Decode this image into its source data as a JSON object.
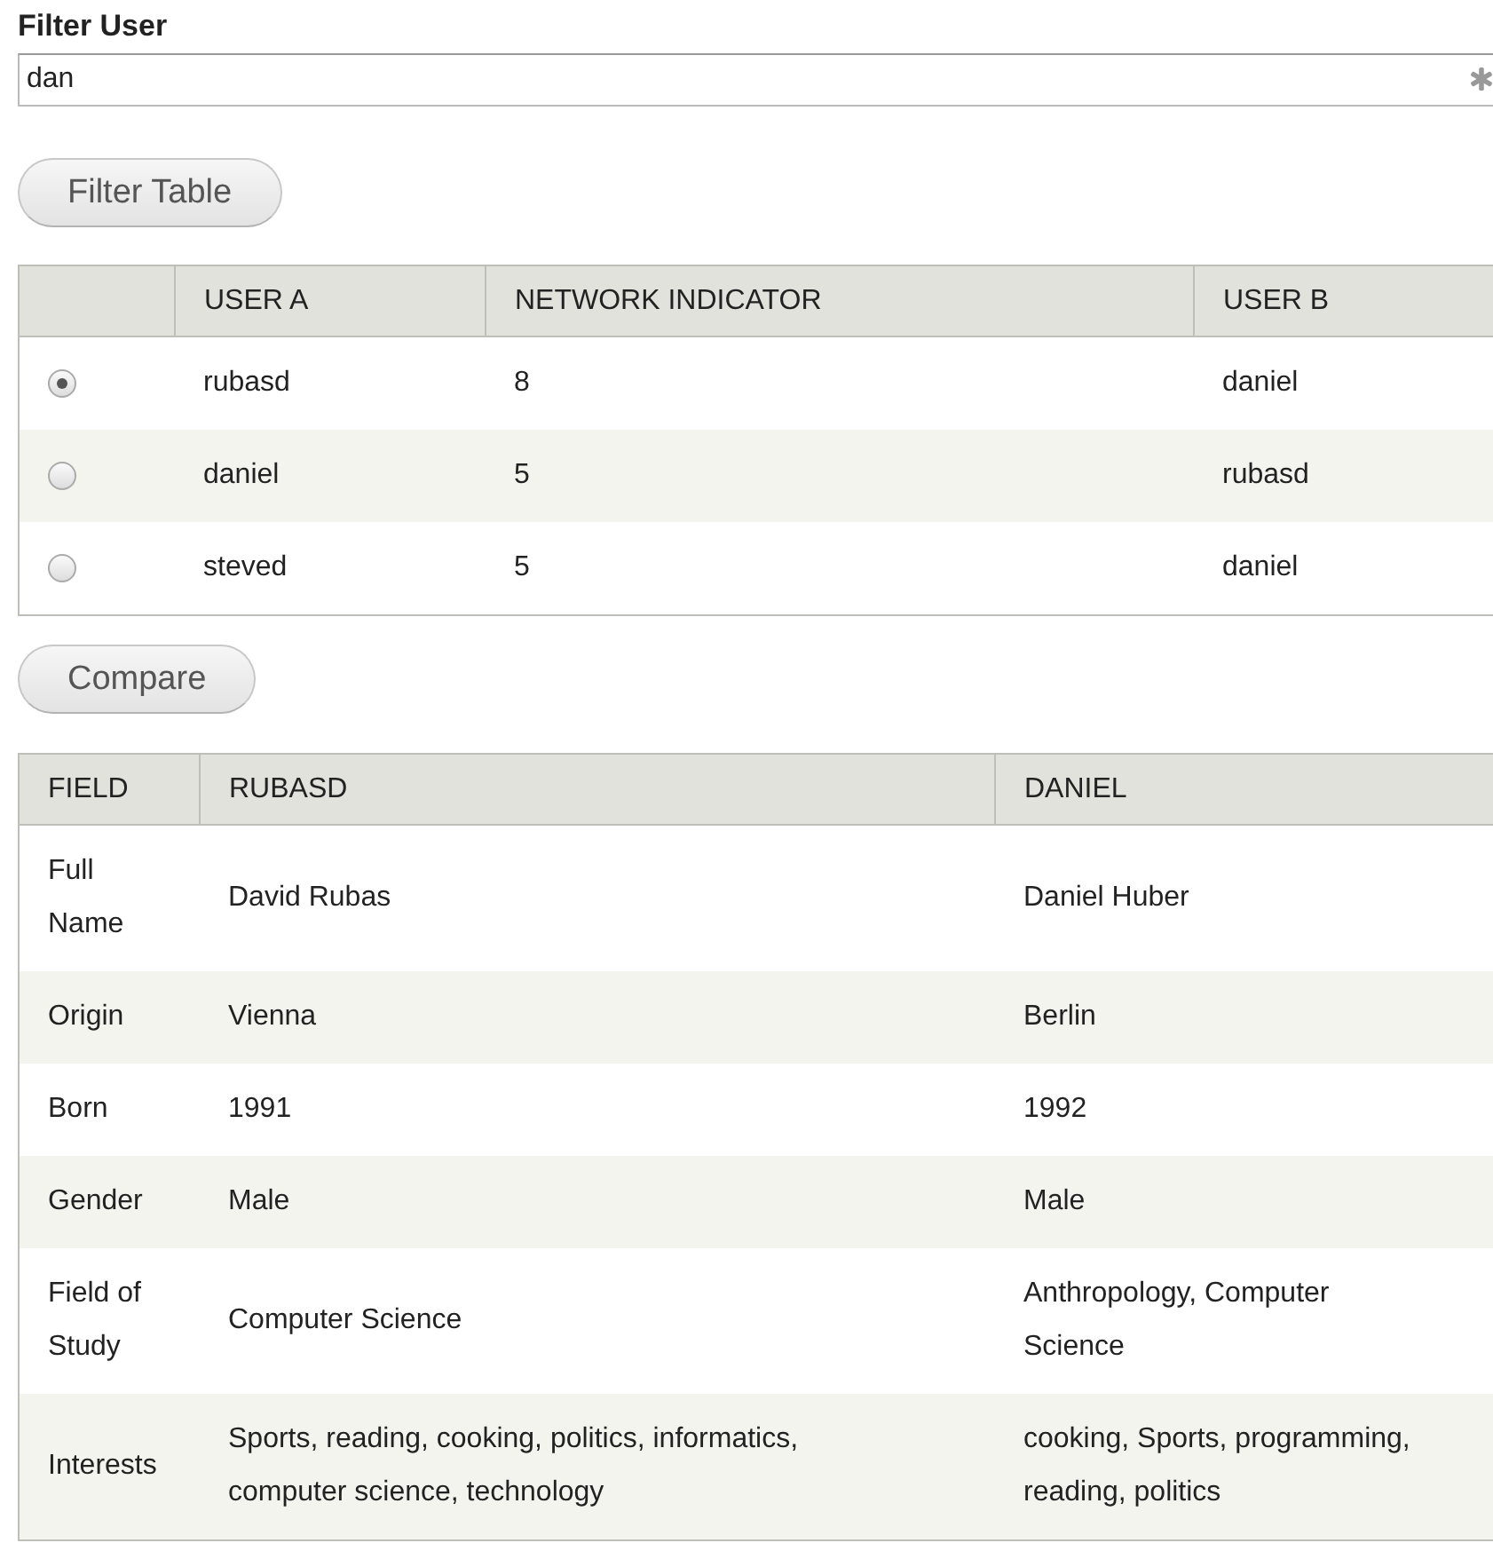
{
  "filter": {
    "label": "Filter User",
    "value": "dan"
  },
  "filter_button": "Filter Table",
  "network_table": {
    "columns": [
      "USER A",
      "NETWORK INDICATOR",
      "USER B"
    ],
    "rows": [
      {
        "selected": true,
        "cells": [
          "rubasd",
          "8",
          "daniel"
        ]
      },
      {
        "selected": false,
        "cells": [
          "daniel",
          "5",
          "rubasd"
        ]
      },
      {
        "selected": false,
        "cells": [
          "steved",
          "5",
          "daniel"
        ]
      }
    ]
  },
  "compare_button": "Compare",
  "compare_table": {
    "columns": [
      "FIELD",
      "RUBASD",
      "DANIEL"
    ],
    "rows": [
      [
        "Full Name",
        "David Rubas",
        "Daniel Huber"
      ],
      [
        "Origin",
        "Vienna",
        "Berlin"
      ],
      [
        "Born",
        "1991",
        "1992"
      ],
      [
        "Gender",
        "Male",
        "Male"
      ],
      [
        "Field of Study",
        "Computer Science",
        "Anthropology, Computer Science"
      ],
      [
        "Interests",
        "Sports, reading, cooking, politics, informatics, computer science, technology",
        "cooking, Sports, programming, reading, politics"
      ]
    ]
  }
}
